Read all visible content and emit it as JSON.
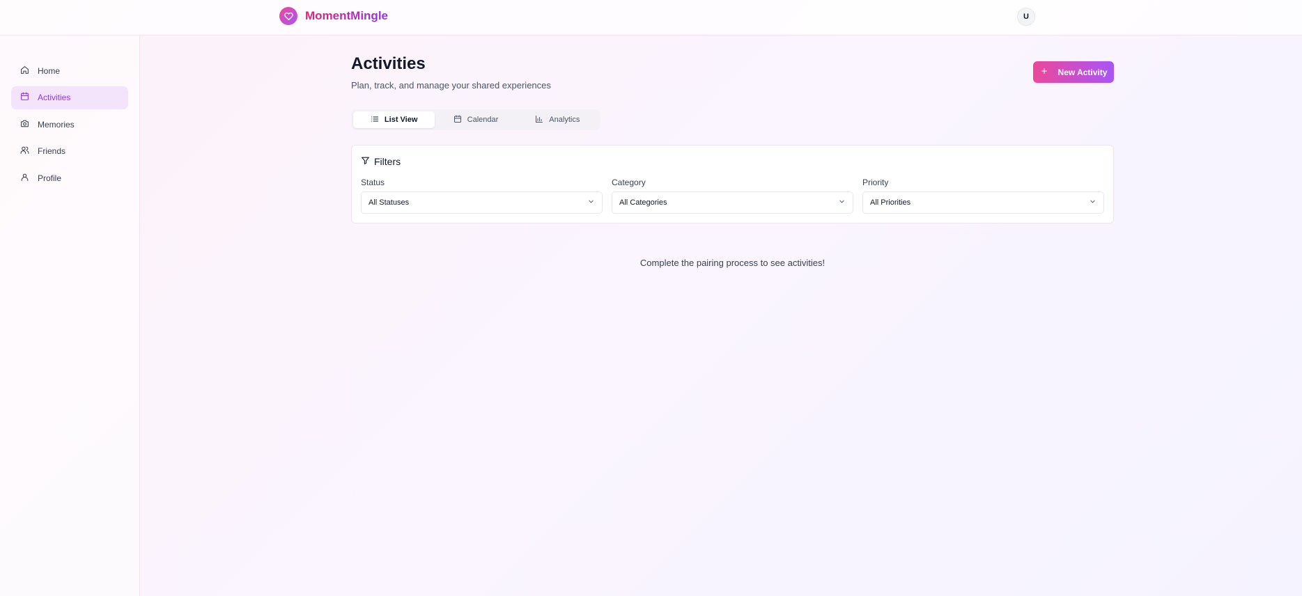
{
  "header": {
    "brand_name": "MomentMingle",
    "avatar_initial": "U"
  },
  "sidebar": {
    "items": [
      {
        "label": "Home",
        "icon": "home-icon"
      },
      {
        "label": "Activities",
        "icon": "calendar-icon",
        "active": true
      },
      {
        "label": "Memories",
        "icon": "camera-icon"
      },
      {
        "label": "Friends",
        "icon": "users-icon"
      },
      {
        "label": "Profile",
        "icon": "user-icon"
      }
    ]
  },
  "main": {
    "title": "Activities",
    "subtitle": "Plan, track, and manage your shared experiences",
    "new_button_label": "New Activity",
    "tabs": [
      {
        "label": "List View",
        "icon": "list-icon",
        "active": true
      },
      {
        "label": "Calendar",
        "icon": "calendar-icon"
      },
      {
        "label": "Analytics",
        "icon": "bar-chart-icon"
      }
    ],
    "filters": {
      "title": "Filters",
      "status": {
        "label": "Status",
        "value": "All Statuses"
      },
      "category": {
        "label": "Category",
        "value": "All Categories"
      },
      "priority": {
        "label": "Priority",
        "value": "All Priorities"
      }
    },
    "empty_message": "Complete the pairing process to see activities!"
  },
  "colors": {
    "accent_pink": "#ec4899",
    "accent_purple": "#a855f7",
    "active_nav_bg": "#f3e3fb",
    "active_nav_text": "#9333ea"
  }
}
